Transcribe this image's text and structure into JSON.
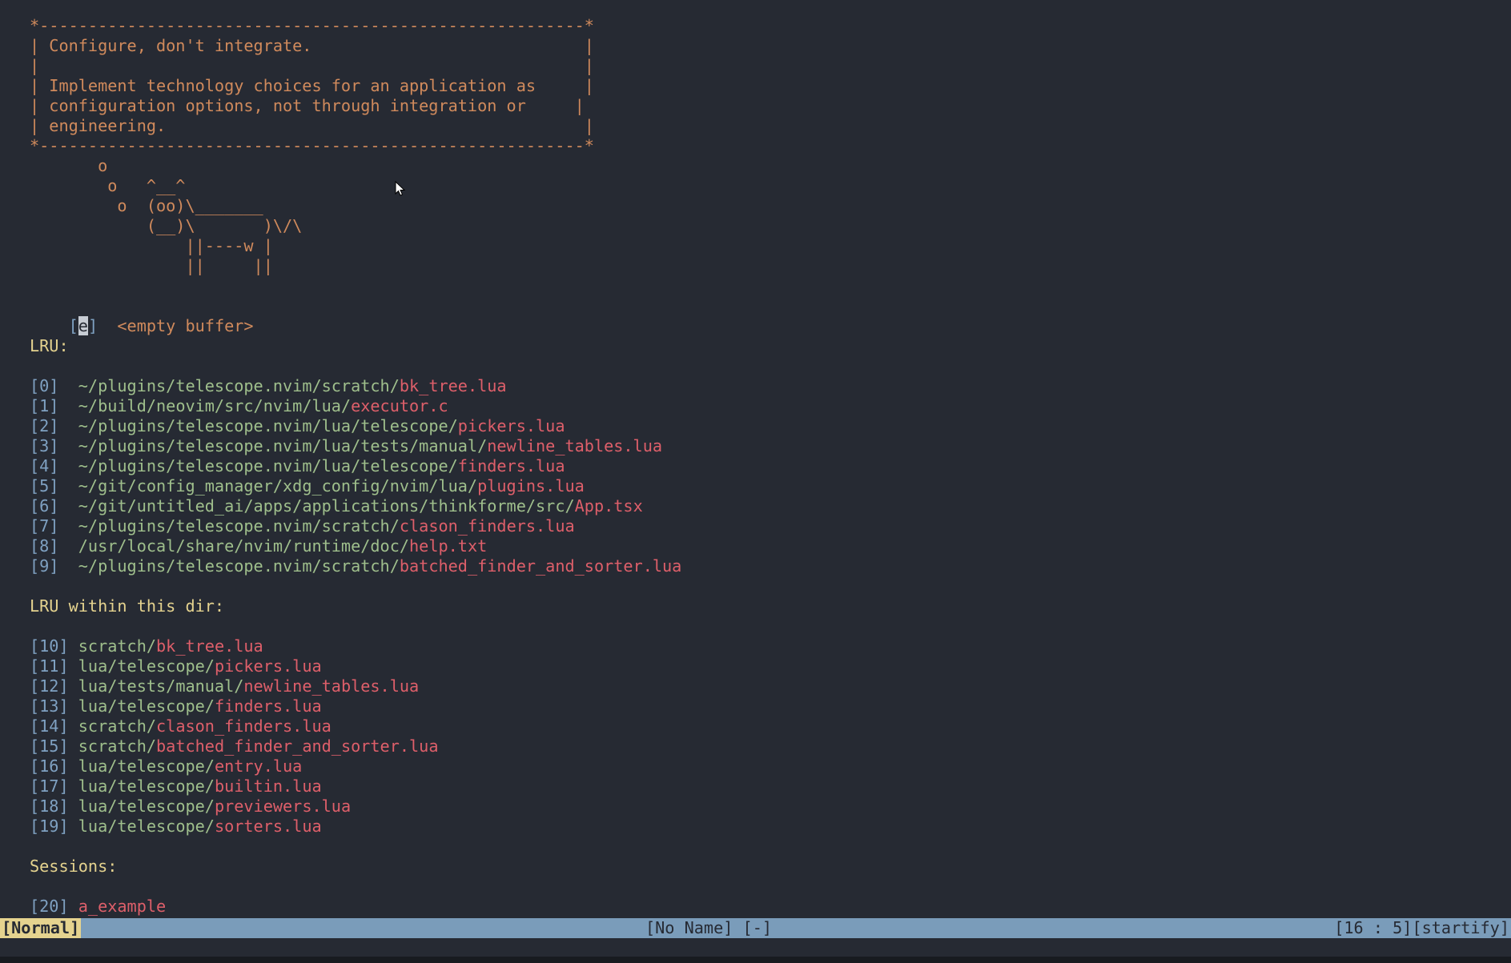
{
  "banner": {
    "lines": [
      "*--------------------------------------------------------*",
      "| Configure, don't integrate.                            |",
      "|                                                        |",
      "| Implement technology choices for an application as     |",
      "| configuration options, not through integration or     |",
      "| engineering.                                           |",
      "*--------------------------------------------------------*"
    ],
    "cow": [
      "       o",
      "        o   ^__^",
      "         o  (oo)\\_______",
      "            (__)\\       )\\/\\",
      "                ||----w |",
      "                ||     ||"
    ]
  },
  "empty_buffer": {
    "bracket_open": "[",
    "key": "e",
    "bracket_close": "]",
    "label": "  <empty buffer>"
  },
  "sections": {
    "lru_header": "LRU:",
    "lru_dir_header": "LRU within this dir:",
    "sessions_header": "Sessions:"
  },
  "lru": [
    {
      "index": "[0]",
      "path": "~/plugins/telescope.nvim/scratch/",
      "file": "bk_tree.lua"
    },
    {
      "index": "[1]",
      "path": "~/build/neovim/src/nvim/lua/",
      "file": "executor.c"
    },
    {
      "index": "[2]",
      "path": "~/plugins/telescope.nvim/lua/telescope/",
      "file": "pickers.lua"
    },
    {
      "index": "[3]",
      "path": "~/plugins/telescope.nvim/lua/tests/manual/",
      "file": "newline_tables.lua"
    },
    {
      "index": "[4]",
      "path": "~/plugins/telescope.nvim/lua/telescope/",
      "file": "finders.lua"
    },
    {
      "index": "[5]",
      "path": "~/git/config_manager/xdg_config/nvim/lua/",
      "file": "plugins.lua"
    },
    {
      "index": "[6]",
      "path": "~/git/untitled_ai/apps/applications/thinkforme/src/",
      "file": "App.tsx"
    },
    {
      "index": "[7]",
      "path": "~/plugins/telescope.nvim/scratch/",
      "file": "clason_finders.lua"
    },
    {
      "index": "[8]",
      "path": "/usr/local/share/nvim/runtime/doc/",
      "file": "help.txt"
    },
    {
      "index": "[9]",
      "path": "~/plugins/telescope.nvim/scratch/",
      "file": "batched_finder_and_sorter.lua"
    }
  ],
  "lru_dir": [
    {
      "index": "[10]",
      "path": "scratch/",
      "file": "bk_tree.lua"
    },
    {
      "index": "[11]",
      "path": "lua/telescope/",
      "file": "pickers.lua"
    },
    {
      "index": "[12]",
      "path": "lua/tests/manual/",
      "file": "newline_tables.lua"
    },
    {
      "index": "[13]",
      "path": "lua/telescope/",
      "file": "finders.lua"
    },
    {
      "index": "[14]",
      "path": "scratch/",
      "file": "clason_finders.lua"
    },
    {
      "index": "[15]",
      "path": "scratch/",
      "file": "batched_finder_and_sorter.lua"
    },
    {
      "index": "[16]",
      "path": "lua/telescope/",
      "file": "entry.lua"
    },
    {
      "index": "[17]",
      "path": "lua/telescope/",
      "file": "builtin.lua"
    },
    {
      "index": "[18]",
      "path": "lua/telescope/",
      "file": "previewers.lua"
    },
    {
      "index": "[19]",
      "path": "lua/telescope/",
      "file": "sorters.lua"
    }
  ],
  "sessions": [
    {
      "index": "[20]",
      "path": "",
      "file": "a_example"
    }
  ],
  "statusbar": {
    "mode": "[Normal]",
    "buffer": "[No Name] [-]",
    "position": "[16 : 5][startify]"
  },
  "colors": {
    "background": "#262a33",
    "banner": "#d08a5c",
    "header": "#e5d38f",
    "index": "#7fa1c2",
    "path": "#9fbf8c",
    "file": "#de5f6a",
    "statusbar": "#7a9cba",
    "mode": "#e5d38f"
  },
  "icons": {
    "mouse_pointer": "arrow-cursor-icon"
  }
}
